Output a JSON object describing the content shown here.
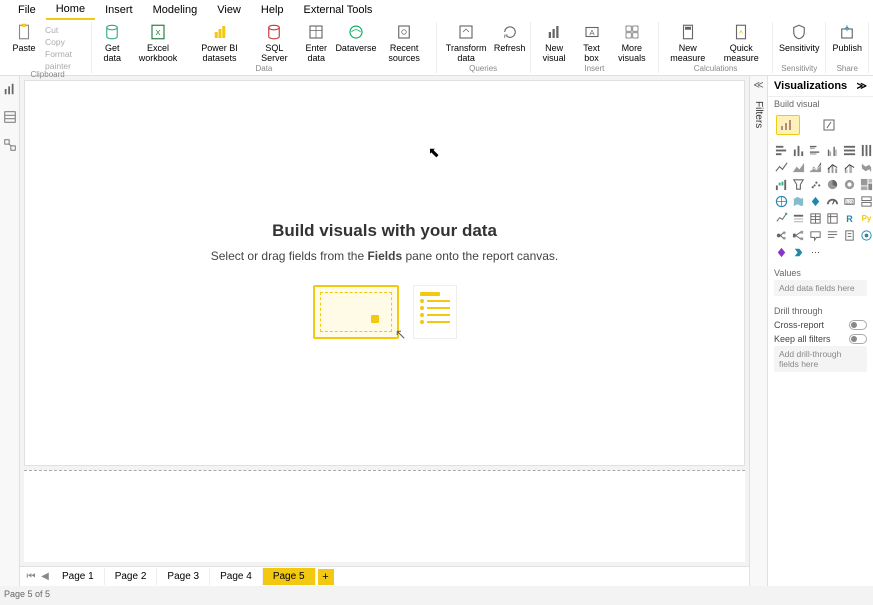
{
  "menu": {
    "items": [
      "File",
      "Home",
      "Insert",
      "Modeling",
      "View",
      "Help",
      "External Tools"
    ],
    "active": "Home"
  },
  "ribbon": {
    "clipboard": {
      "label": "Clipboard",
      "paste": "Paste",
      "cut": "Cut",
      "copy": "Copy",
      "format": "Format painter"
    },
    "data": {
      "label": "Data",
      "get": "Get data",
      "excel": "Excel workbook",
      "pbi": "Power BI datasets",
      "sql": "SQL Server",
      "enter": "Enter data",
      "dataverse": "Dataverse",
      "recent": "Recent sources"
    },
    "queries": {
      "label": "Queries",
      "transform": "Transform data",
      "refresh": "Refresh"
    },
    "insert": {
      "label": "Insert",
      "newvis": "New visual",
      "text": "Text box",
      "more": "More visuals"
    },
    "calc": {
      "label": "Calculations",
      "newmeas": "New measure",
      "quick": "Quick measure"
    },
    "sens": {
      "label": "Sensitivity",
      "btn": "Sensitivity"
    },
    "share": {
      "label": "Share",
      "publish": "Publish"
    }
  },
  "canvas": {
    "title": "Build visuals with your data",
    "subtitle_pre": "Select or drag fields from the ",
    "subtitle_bold": "Fields",
    "subtitle_post": " pane onto the report canvas."
  },
  "filters_label": "Filters",
  "viz": {
    "title": "Visualizations",
    "subtitle": "Build visual",
    "values_label": "Values",
    "values_placeholder": "Add data fields here",
    "drill_label": "Drill through",
    "cross_report": "Cross-report",
    "keep_filters": "Keep all filters",
    "drill_placeholder": "Add drill-through fields here"
  },
  "pages": {
    "items": [
      "Page 1",
      "Page 2",
      "Page 3",
      "Page 4",
      "Page 5"
    ],
    "active": "Page 5"
  },
  "status": "Page 5 of 5"
}
